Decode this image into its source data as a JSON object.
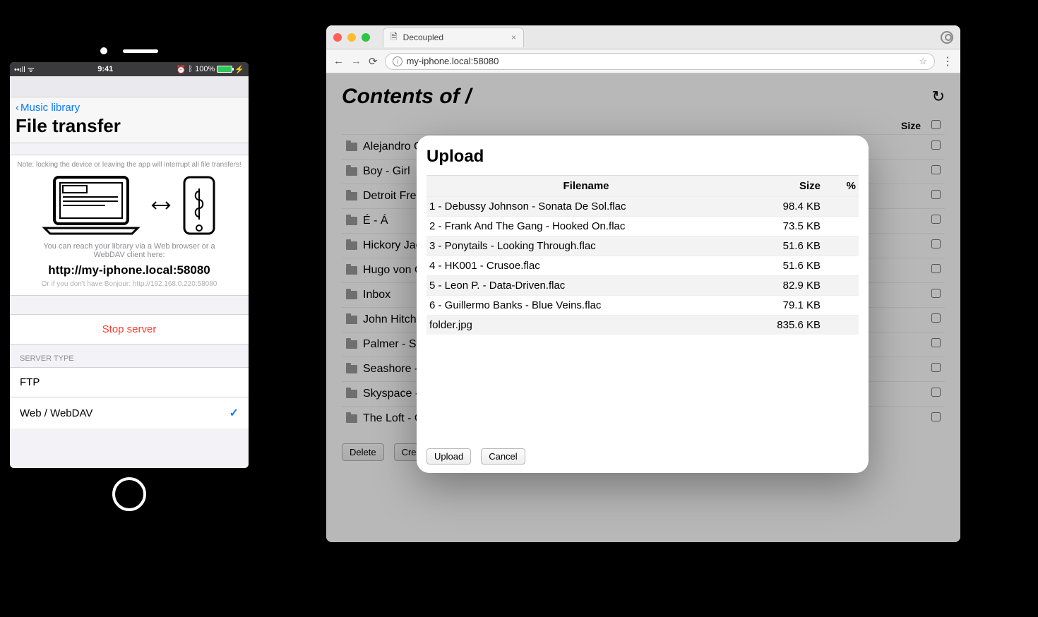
{
  "phone": {
    "status": {
      "time": "9:41",
      "battery": "100%"
    },
    "nav_back": "Music library",
    "title": "File transfer",
    "note": "Note: locking the device or leaving the app will interrupt all file transfers!",
    "reach_text": "You can reach your library via a Web browser or a WebDAV client here:",
    "url": "http://my-iphone.local:58080",
    "bonjour": "Or if you don't have Bonjour: http://192.168.0.220:58080",
    "stop_server": "Stop server",
    "server_type_header": "SERVER TYPE",
    "options": {
      "ftp": "FTP",
      "webdav": "Web / WebDAV"
    }
  },
  "browser": {
    "tab_title": "Decoupled",
    "address": "my-iphone.local:58080",
    "page_title": "Contents of /",
    "columns": {
      "size": "Size"
    },
    "rows": [
      {
        "name": "Alejandro Ca"
      },
      {
        "name": "Boy - Girl"
      },
      {
        "name": "Detroit Frequ"
      },
      {
        "name": "É - Á"
      },
      {
        "name": "Hickory Jack"
      },
      {
        "name": "Hugo von Ca"
      },
      {
        "name": "Inbox"
      },
      {
        "name": "John Hitchen"
      },
      {
        "name": "Palmer - Sur"
      },
      {
        "name": "Seashore - S"
      },
      {
        "name": "Skyspace - V"
      },
      {
        "name": "The Loft - Collective"
      }
    ],
    "delete_btn": "Delete",
    "create_dir_btn": "Create Directory"
  },
  "modal": {
    "title": "Upload",
    "columns": {
      "filename": "Filename",
      "size": "Size",
      "pct": "%"
    },
    "files": [
      {
        "name": "1 - Debussy Johnson - Sonata De Sol.flac",
        "size": "98.4 KB"
      },
      {
        "name": "2 - Frank And The Gang - Hooked On.flac",
        "size": "73.5 KB"
      },
      {
        "name": "3 - Ponytails - Looking Through.flac",
        "size": "51.6 KB"
      },
      {
        "name": "4 - HK001 - Crusoe.flac",
        "size": "51.6 KB"
      },
      {
        "name": "5 - Leon P. - Data-Driven.flac",
        "size": "82.9 KB"
      },
      {
        "name": "6 - Guillermo Banks - Blue Veins.flac",
        "size": "79.1 KB"
      },
      {
        "name": "folder.jpg",
        "size": "835.6 KB"
      }
    ],
    "upload_btn": "Upload",
    "cancel_btn": "Cancel"
  }
}
